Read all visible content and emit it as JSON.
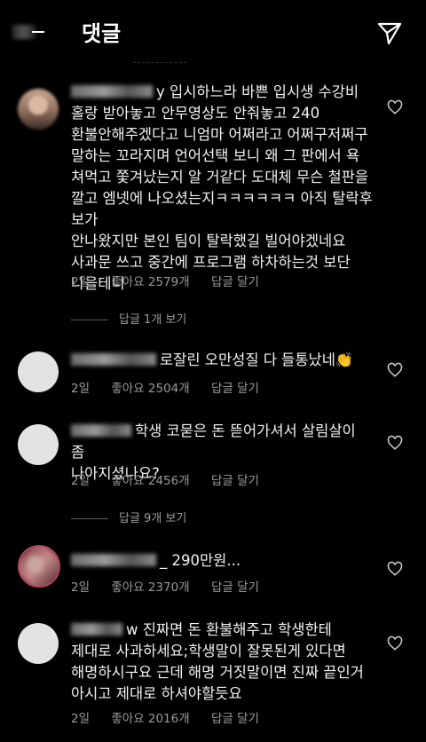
{
  "header": {
    "title": "댓글",
    "send_icon": "paper-plane-icon",
    "back_icon": "back-arrow-icon"
  },
  "comments": [
    {
      "text": "y 입시하느라 바쁜 입시생 수강비\n홀랑 받아놓고 안무영상도 안줘놓고 240\n환불안해주겠다고 니엄마 어쩌라고 어쩌구저쩌구\n말하는 꼬라지며 언어선택 보니 왜 그 판에서 욕\n쳐먹고 쫓겨났는지 알 거같다 도대체 무슨 철판을\n깔고 엠넷에 나오셨는지ㅋㅋㅋㅋㅋㅋ 아직 탈락후보가\n안나왔지만 본인 팀이 탈락했길 빌어야겠네요\n사과문 쓰고 중간에 프로그램 하차하는것 보단\n나을테니",
      "time": "2일",
      "likes": "좋아요 2579개",
      "reply": "답글 달기",
      "view_replies": "답글 1개 보기"
    },
    {
      "text": "로잘린 오만성질 다 들통났네👏",
      "time": "2일",
      "likes": "좋아요 2504개",
      "reply": "답글 달기"
    },
    {
      "text": "학생 코묻은 돈 뜯어가셔서 살림살이 좀\n나아지셨나요?",
      "time": "2일",
      "likes": "좋아요 2456개",
      "reply": "답글 달기",
      "view_replies": "답글 9개 보기"
    },
    {
      "text": "_ 290만원...",
      "time": "2일",
      "likes": "좋아요 2370개",
      "reply": "답글 달기"
    },
    {
      "text": "w 진짜면 돈 환불해주고 학생한테\n제대로 사과하세요;학생말이 잘못된게 있다면\n해명하시구요 근데 해명 거짓말이면 진짜 끝인거\n아시고 제대로 하셔야할듯요",
      "time": "2일",
      "likes": "좋아요 2016개",
      "reply": "답글 달기"
    }
  ]
}
